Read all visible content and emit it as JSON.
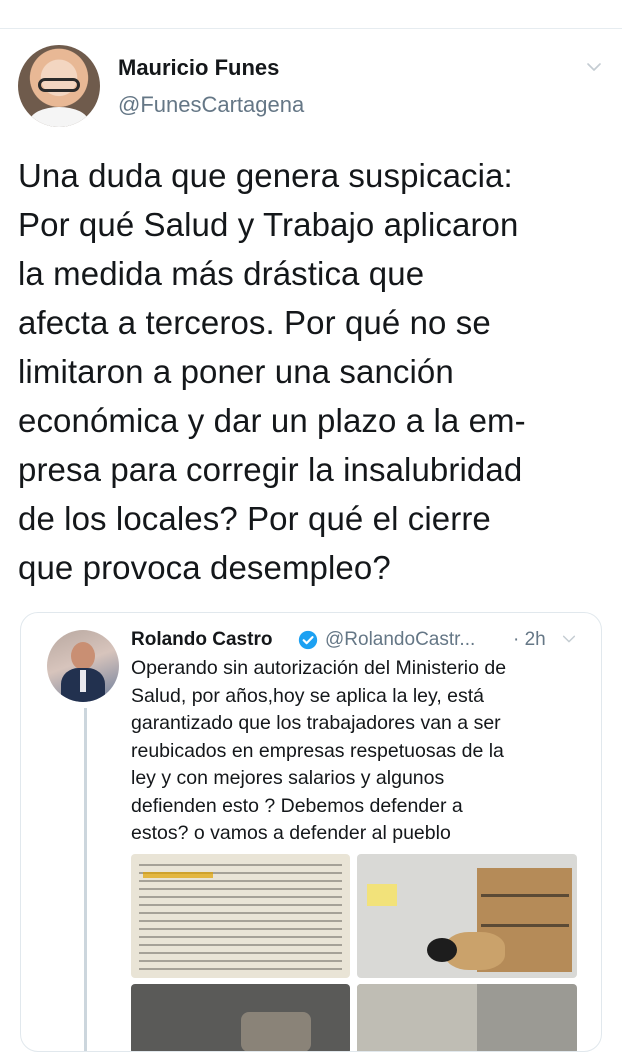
{
  "tweet": {
    "author_name": "Mauricio Funes",
    "author_handle": "@FunesCartagena",
    "text": "Una duda que genera suspicacia:\nPor qué Salud y Trabajo aplicaron\nla medida más drástica que\nafecta a terceros. Por qué no se\nlimitaron a poner una sanción\neconómica y dar un plazo a la em-\npresa para corregir la insalubridad\nde los locales? Por qué el cierre\nque provoca desempleo?"
  },
  "quoted_tweet": {
    "author_name": "Rolando Castro",
    "author_handle": "@RolandoCastr...",
    "time": "· 2h",
    "text": "Operando sin autorización del Ministerio de\nSalud, por años,hoy se aplica la ley, está\ngarantizado que los trabajadores van a ser\nreubicados en empresas respetuosas de la\nley y con mejores salarios y algunos\ndefienden esto ? Debemos defender a\nestos? o vamos a defender al pueblo",
    "verified": true
  },
  "icons": {
    "menu": "chevron-down-icon",
    "verified": "verified-badge-icon"
  },
  "colors": {
    "text_primary": "#14171a",
    "text_secondary": "#657786",
    "verified_blue": "#1da1f2",
    "border": "#e1e8ed"
  }
}
